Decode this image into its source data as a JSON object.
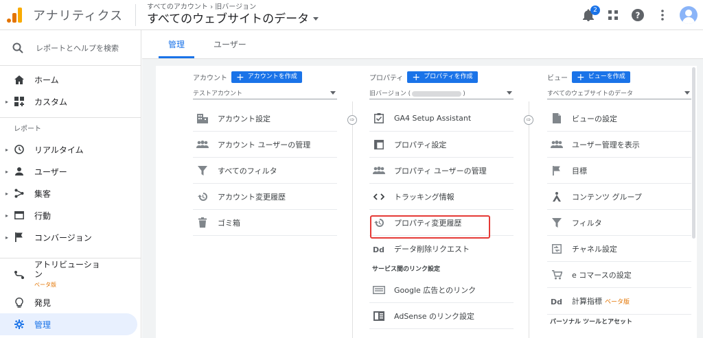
{
  "header": {
    "app_title": "アナリティクス",
    "account_path": "すべてのアカウント › 旧バージョン",
    "view_title": "すべてのウェブサイトのデータ",
    "notification_count": "2"
  },
  "sidebar": {
    "search_placeholder": "レポートとヘルプを検索",
    "home": "ホーム",
    "custom": "カスタム",
    "reports_section": "レポート",
    "realtime": "リアルタイム",
    "users": "ユーザー",
    "acquisition": "集客",
    "behavior": "行動",
    "conversions": "コンバージョン",
    "attribution": "アトリビューション",
    "attribution_beta": "ベータ版",
    "discover": "発見",
    "admin": "管理"
  },
  "tabs": [
    {
      "label": "管理",
      "active": true
    },
    {
      "label": "ユーザー",
      "active": false
    }
  ],
  "account_col": {
    "label": "アカウント",
    "create_button": "アカウントを作成",
    "selected": "テストアカウント",
    "items": [
      "アカウント設定",
      "アカウント ユーザーの管理",
      "すべてのフィルタ",
      "アカウント変更履歴",
      "ゴミ箱"
    ]
  },
  "property_col": {
    "label": "プロパティ",
    "create_button": "プロパティを作成",
    "selected_prefix": "旧バージョン (",
    "selected_suffix": ")",
    "items": [
      "GA4 Setup Assistant",
      "プロパティ設定",
      "プロパティ ユーザーの管理",
      "トラッキング情報",
      "プロパティ変更履歴",
      "データ削除リクエスト"
    ],
    "link_section": "サービス間のリンク設定",
    "link_items": [
      "Google 広告とのリンク",
      "AdSense のリンク設定"
    ]
  },
  "view_col": {
    "label": "ビュー",
    "create_button": "ビューを作成",
    "selected": "すべてのウェブサイトのデータ",
    "items": [
      "ビューの設定",
      "ユーザー管理を表示",
      "目標",
      "コンテンツ グループ",
      "フィルタ",
      "チャネル設定",
      "e コマースの設定"
    ],
    "calc_metrics": "計算指標",
    "calc_beta": "ベータ版",
    "personal_section": "パーソナル ツールとアセット"
  },
  "colors": {
    "accent": "#1a73e8",
    "highlight": "#e53935",
    "logo_orange": "#e37400"
  }
}
